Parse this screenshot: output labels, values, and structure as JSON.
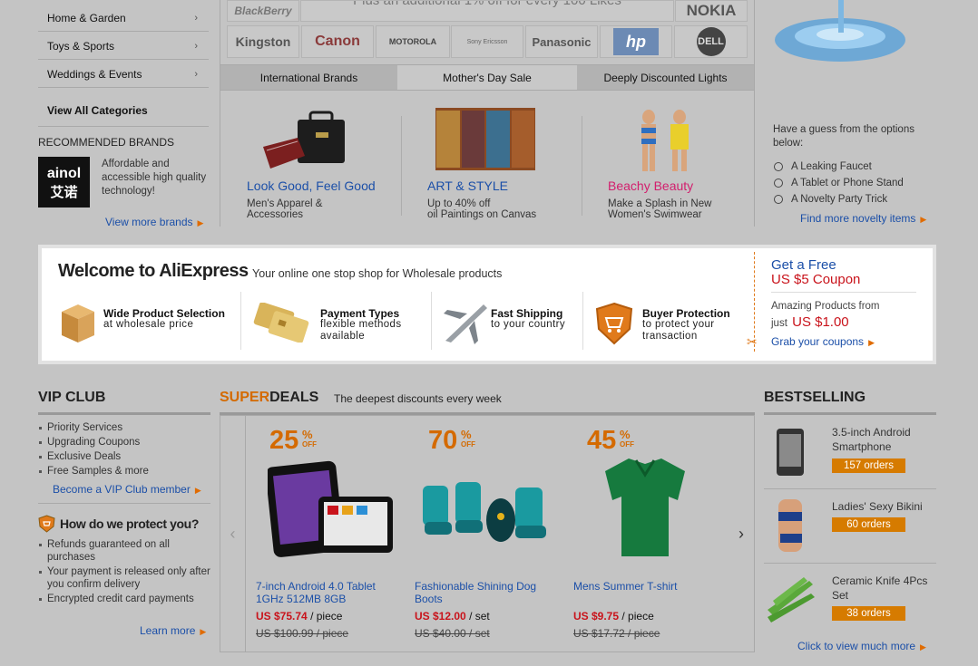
{
  "categories": [
    {
      "label": "Home & Garden"
    },
    {
      "label": "Toys & Sports"
    },
    {
      "label": "Weddings & Events"
    }
  ],
  "view_all": "View All Categories",
  "recommended": {
    "heading": "RECOMMENDED BRANDS",
    "logo_text_top": "ainol",
    "logo_text_bottom": "艾诺",
    "desc": "Affordable and accessible high quality technology!",
    "more": "View more brands"
  },
  "brands": {
    "row1": [
      "BlackBerry",
      "NOKIA"
    ],
    "row2": [
      "Kingston",
      "Canon",
      "MOTOROLA",
      "Sony Ericsson",
      "Panasonic",
      "hp",
      "DELL"
    ],
    "banner_text": "Plus an additional 1% off for every 100 Likes"
  },
  "tabs": [
    "International Brands",
    "Mother's Day Sale",
    "Deeply Discounted Lights"
  ],
  "promos": [
    {
      "title": "Look Good, Feel Good",
      "sub1": "Men's Apparel &",
      "sub2": "Accessories",
      "color": "#1b4fa8"
    },
    {
      "title": "ART & STYLE",
      "sub1": "Up to 40% off",
      "sub2": "oil Paintings on Canvas",
      "color": "#1b4fa8"
    },
    {
      "title": "Beachy Beauty",
      "sub1": "Make a Splash in New",
      "sub2": "Women's Swimwear",
      "color": "#d21e6d"
    }
  ],
  "poll": {
    "question": "Have a guess from the options below:",
    "options": [
      "A Leaking Faucet",
      "A Tablet or Phone Stand",
      "A Novelty Party Trick"
    ],
    "more": "Find more novelty items"
  },
  "welcome": {
    "title": "Welcome to AliExpress",
    "tagline": "Your online one stop shop for Wholesale products",
    "features": [
      {
        "title": "Wide Product Selection",
        "sub": "at wholesale price"
      },
      {
        "title": "Payment Types",
        "sub": "flexible methods available"
      },
      {
        "title": "Fast Shipping",
        "sub": "to your country"
      },
      {
        "title": "Buyer Protection",
        "sub": "to protect your transaction"
      }
    ],
    "coupon_line1": "Get a Free",
    "coupon_line2": "US $5 Coupon",
    "amazing_line1": "Amazing Products from",
    "amazing_just": "just",
    "amazing_price": "US $1.00",
    "grab": "Grab your coupons"
  },
  "vip": {
    "heading": "VIP CLUB",
    "items": [
      "Priority Services",
      "Upgrading Coupons",
      "Exclusive Deals",
      "Free Samples & more"
    ],
    "link": "Become a VIP Club member"
  },
  "protect": {
    "heading": "How do we protect you?",
    "items": [
      "Refunds guaranteed on all purchases",
      "Your payment is released only after you confirm delivery",
      "Encrypted credit card payments"
    ],
    "link": "Learn more"
  },
  "superdeals": {
    "heading_super": "SUPER",
    "heading_deals": "DEALS",
    "tagline": "The deepest discounts every week",
    "items": [
      {
        "pct": "25",
        "name": "7-inch Android 4.0 Tablet 1GHz 512MB 8GB",
        "price": "US $75.74",
        "unit": "/ piece",
        "old": "US $100.99 / piece"
      },
      {
        "pct": "70",
        "name": "Fashionable Shining Dog Boots",
        "price": "US $12.00",
        "unit": "/ set",
        "old": "US $40.00 / set"
      },
      {
        "pct": "45",
        "name": "Mens Summer T-shirt",
        "price": "US $9.75",
        "unit": "/ piece",
        "old": "US $17.72 / piece"
      }
    ],
    "pct_sign": "%",
    "off": "OFF"
  },
  "bestselling": {
    "heading": "BESTSELLING",
    "items": [
      {
        "name": "3.5-inch Android Smartphone",
        "orders": "157 orders"
      },
      {
        "name": "Ladies' Sexy Bikini",
        "orders": "60 orders"
      },
      {
        "name": "Ceramic Knife 4Pcs Set",
        "orders": "38 orders"
      }
    ],
    "more": "Click to view much more"
  }
}
